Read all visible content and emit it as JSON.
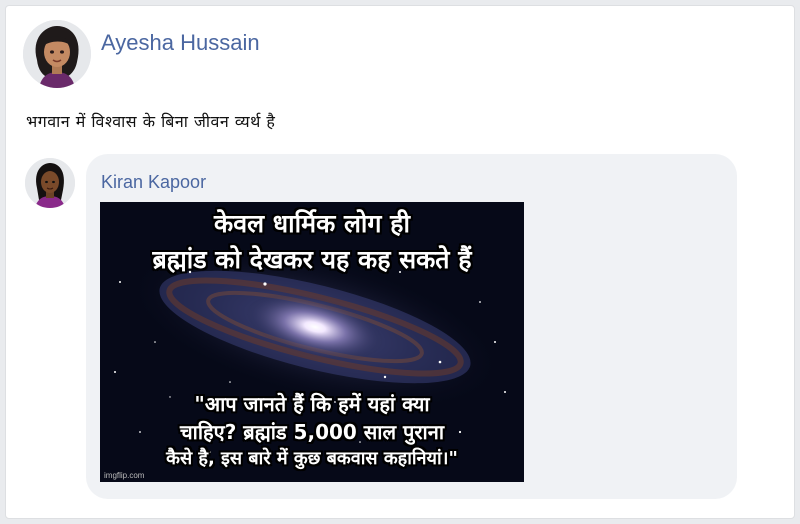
{
  "post": {
    "author": "Ayesha Hussain",
    "text": "भगवान में विश्वास के बिना जीवन व्यर्थ है"
  },
  "comment": {
    "author": "Kiran Kapoor",
    "meme": {
      "top_lines": [
        "केवल धार्मिक लोग ही",
        "ब्रह्मांड को देखकर यह कह सकते हैं"
      ],
      "bottom_lines": [
        "\"आप जानते हैं कि हमें यहां क्या",
        "चाहिए? ब्रह्मांड 5,000 साल पुराना",
        "कैसे है, इस बारे में कुछ बकवास कहानियां।\""
      ],
      "watermark": "imgflip.com"
    }
  }
}
